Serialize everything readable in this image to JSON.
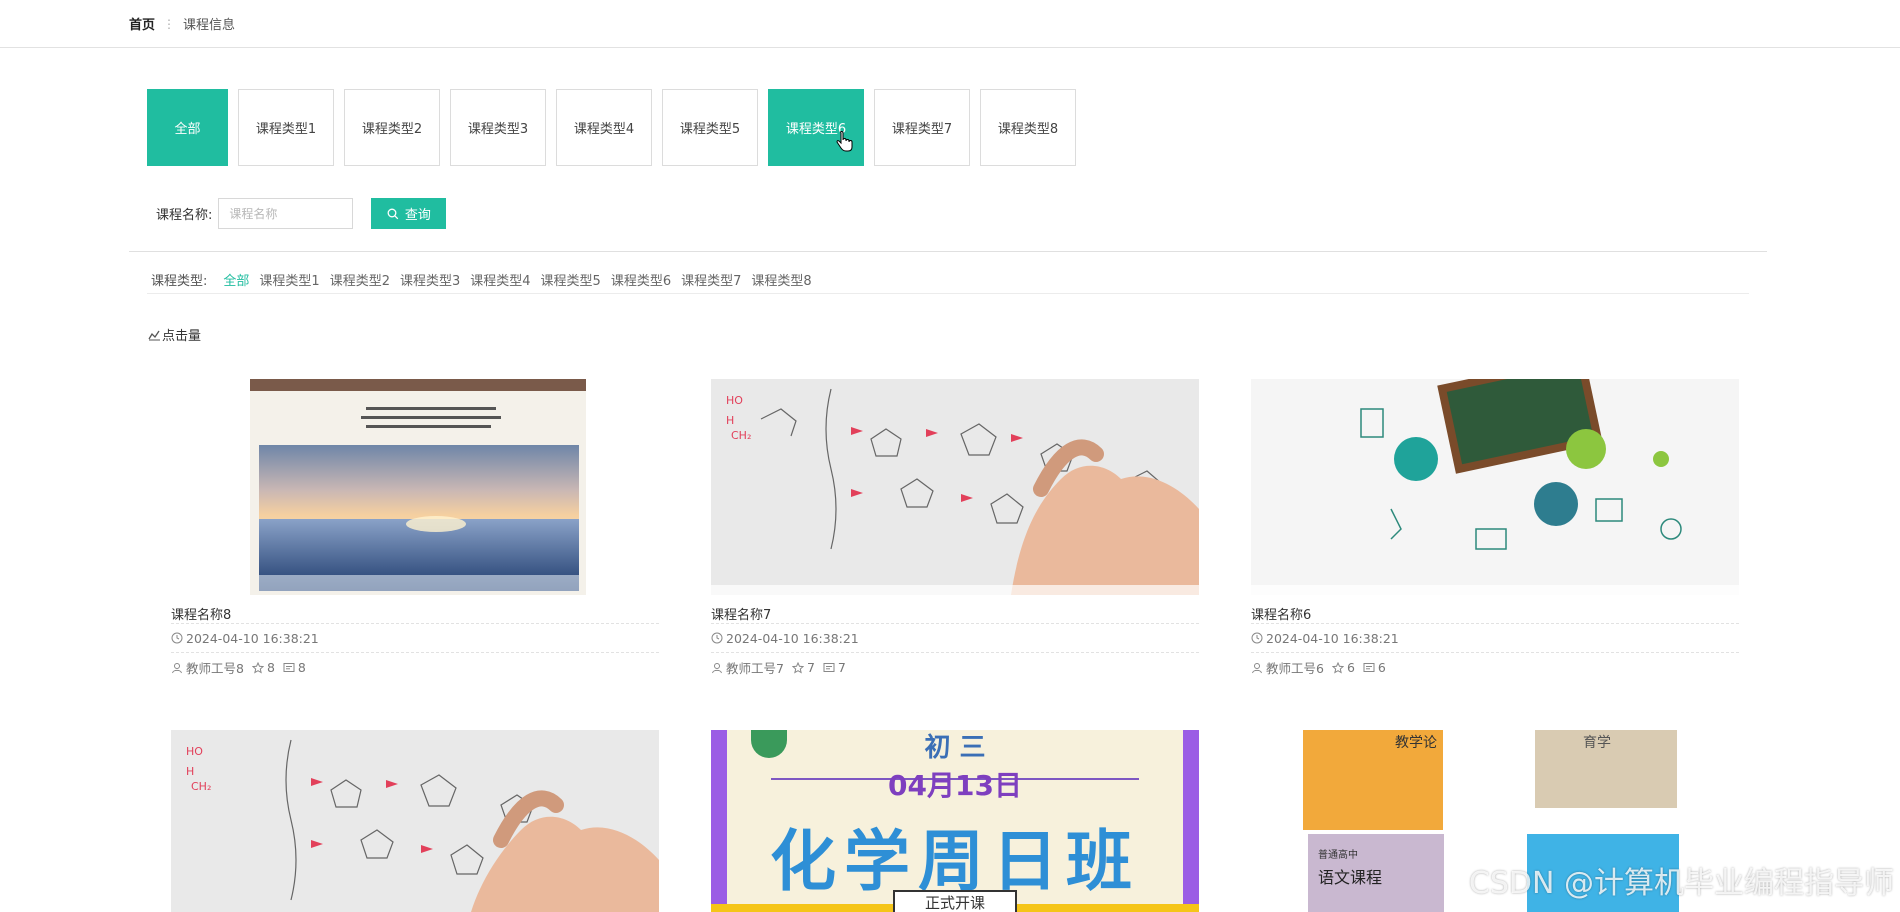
{
  "breadcrumb": {
    "home": "首页",
    "separator": "⋮",
    "current": "课程信息"
  },
  "type_tabs": [
    {
      "label": "全部",
      "active": true
    },
    {
      "label": "课程类型1",
      "active": false
    },
    {
      "label": "课程类型2",
      "active": false
    },
    {
      "label": "课程类型3",
      "active": false
    },
    {
      "label": "课程类型4",
      "active": false
    },
    {
      "label": "课程类型5",
      "active": false
    },
    {
      "label": "课程类型6",
      "active": true
    },
    {
      "label": "课程类型7",
      "active": false
    },
    {
      "label": "课程类型8",
      "active": false
    }
  ],
  "search": {
    "label": "课程名称:",
    "placeholder": "课程名称",
    "value": "",
    "button_label": "查询"
  },
  "filter": {
    "label": "课程类型:",
    "items": [
      "全部",
      "课程类型1",
      "课程类型2",
      "课程类型3",
      "课程类型4",
      "课程类型5",
      "课程类型6",
      "课程类型7",
      "课程类型8"
    ],
    "active_index": 0
  },
  "sort": {
    "label": "点击量"
  },
  "cards": [
    {
      "title": "课程名称8",
      "datetime": "2024-04-10 16:38:21",
      "teacher": "教师工号8",
      "stars": "8",
      "comments": "8",
      "image": "textbook-cover-sea"
    },
    {
      "title": "课程名称7",
      "datetime": "2024-04-10 16:38:21",
      "teacher": "教师工号7",
      "stars": "7",
      "comments": "7",
      "image": "chemistry-hand"
    },
    {
      "title": "课程名称6",
      "datetime": "2024-04-10 16:38:21",
      "teacher": "教师工号6",
      "stars": "6",
      "comments": "6",
      "image": "school-chalkboard"
    },
    {
      "image": "chemistry-hand"
    },
    {
      "image": "chemistry-poster",
      "poster": {
        "line1": "初 三",
        "date": "04月13日",
        "headline": "化学周日班",
        "footer": "正式开课"
      }
    },
    {
      "image": "books-collage",
      "book_texts": [
        "教学论",
        "育学",
        "语文课程",
        "普通高中"
      ]
    }
  ],
  "colors": {
    "accent": "#20bda0",
    "border": "#dcdcdc",
    "text": "#333333",
    "muted": "#777777"
  },
  "watermark": "CSDN @计算机毕业编程指导师"
}
